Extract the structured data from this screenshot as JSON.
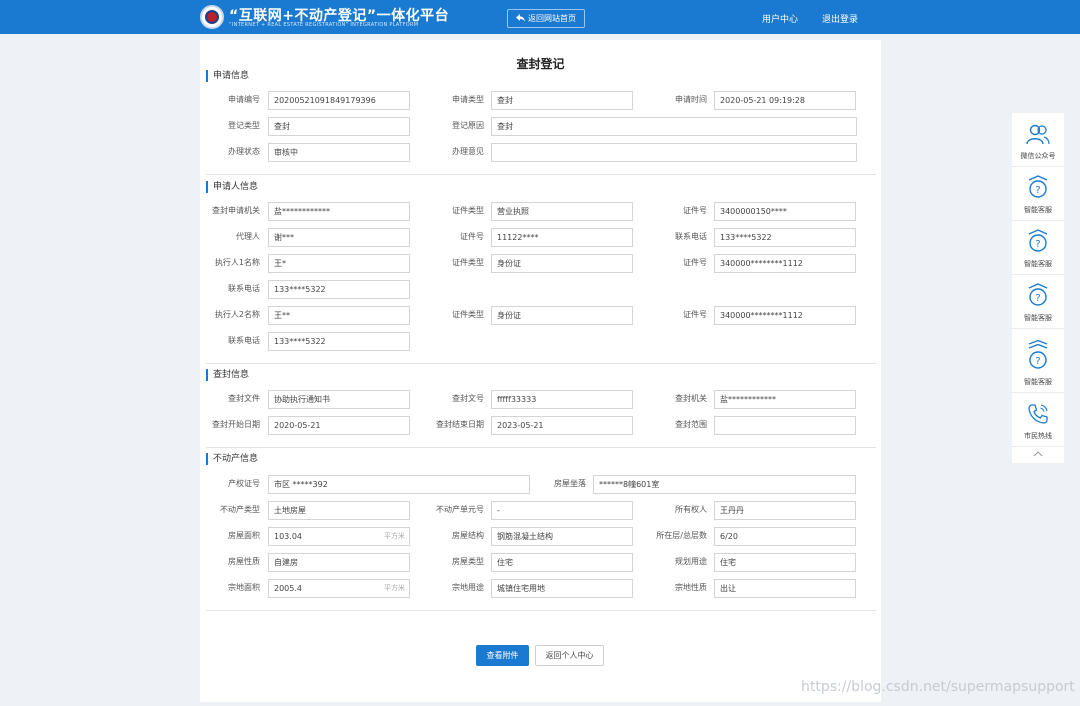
{
  "header": {
    "title": "“互联网+不动产登记”一体化平台",
    "subtitle": "“INTERNET + REAL ESTATE REGISTRATION” INTEGRATION PLATFORM",
    "home_button": "返回网站首页",
    "user_center": "用户中心",
    "logout": "退出登录"
  },
  "page": {
    "title": "查封登记"
  },
  "sections": {
    "application": "申请信息",
    "applicant": "申请人信息",
    "seizure": "查封信息",
    "property": "不动产信息"
  },
  "application": {
    "apply_no_label": "申请编号",
    "apply_no": "20200521091849179396",
    "apply_type_label": "申请类型",
    "apply_type": "查封",
    "apply_time_label": "申请时间",
    "apply_time": "2020-05-21 09:19:28",
    "reg_type_label": "登记类型",
    "reg_type": "查封",
    "reg_reason_label": "登记原因",
    "reg_reason": "查封",
    "status_label": "办理状态",
    "status": "审核中",
    "opinion_label": "办理意见",
    "opinion": ""
  },
  "applicant": {
    "org_label": "查封申请机关",
    "org": "盐************",
    "id_type_label": "证件类型",
    "id_type": "营业执照",
    "id_no_label": "证件号",
    "id_no": "3400000150****",
    "agent_label": "代理人",
    "agent": "谢***",
    "agent_id_label": "证件号",
    "agent_id": "11122****",
    "agent_phone_label": "联系电话",
    "agent_phone": "133****5322",
    "exec1_label": "执行人1名称",
    "exec1": "王*",
    "exec1_id_type_label": "证件类型",
    "exec1_id_type": "身份证",
    "exec1_id_label": "证件号",
    "exec1_id": "340000********1112",
    "exec1_phone_label": "联系电话",
    "exec1_phone": "133****5322",
    "exec2_label": "执行人2名称",
    "exec2": "王**",
    "exec2_id_type_label": "证件类型",
    "exec2_id_type": "身份证",
    "exec2_id_label": "证件号",
    "exec2_id": "340000********1112",
    "exec2_phone_label": "联系电话",
    "exec2_phone": "133****5322"
  },
  "seizure": {
    "doc_label": "查封文件",
    "doc": "协助执行通知书",
    "doc_no_label": "查封文号",
    "doc_no": "fffff33333",
    "org_label": "查封机关",
    "org": "盐************",
    "start_label": "查封开始日期",
    "start": "2020-05-21",
    "end_label": "查封结束日期",
    "end": "2023-05-21",
    "scope_label": "查封范围",
    "scope": ""
  },
  "property": {
    "cert_label": "产权证号",
    "cert": "市区 *****392",
    "location_label": "房屋坐落",
    "location": "******8幢601室",
    "type_label": "不动产类型",
    "type": "土地房屋",
    "unit_no_label": "不动产单元号",
    "unit_no": "-",
    "owner_label": "所有权人",
    "owner": "王丹丹",
    "area_label": "房屋面积",
    "area": "103.04",
    "area_unit": "平方米",
    "structure_label": "房屋结构",
    "structure": "钢筋混凝土结构",
    "floor_label": "所在层/总层数",
    "floor": "6/20",
    "nature_label": "房屋性质",
    "nature": "自建房",
    "house_type_label": "房屋类型",
    "house_type": "住宅",
    "plan_use_label": "规划用途",
    "plan_use": "住宅",
    "land_area_label": "宗地面积",
    "land_area": "2005.4",
    "land_area_unit": "平方米",
    "land_use_label": "宗地用途",
    "land_use": "城镇住宅用地",
    "land_nature_label": "宗地性质",
    "land_nature": "出让"
  },
  "buttons": {
    "view_attachment": "查看附件",
    "back": "返回个人中心"
  },
  "sidebar": {
    "items": [
      {
        "label": "微信公众号",
        "icon": "users-icon"
      },
      {
        "label": "智能客服",
        "icon": "robot-icon"
      },
      {
        "label": "智能客服",
        "icon": "robot-icon"
      },
      {
        "label": "智能客服",
        "icon": "robot-icon"
      },
      {
        "label": "智能客服",
        "icon": "robot-icon"
      },
      {
        "label": "市民热线",
        "icon": "phone-icon"
      }
    ]
  },
  "watermark": "https://blog.csdn.net/supermapsupport",
  "colors": {
    "primary": "#1a7ad1",
    "background": "#eef1f5"
  }
}
